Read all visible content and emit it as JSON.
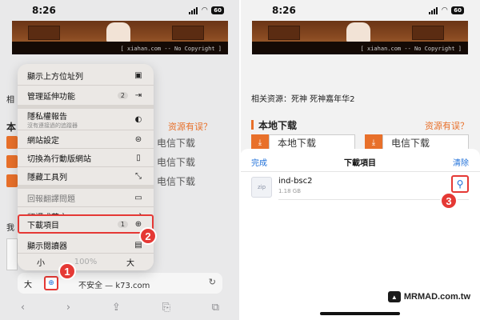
{
  "left": {
    "status_time": "8:26",
    "battery": "60",
    "banner_copyright": "[ xiahan.com -- No Copyright ]",
    "page_frag_related": "相",
    "page_frag_local": "本",
    "page_warn": "资源有误？",
    "page_dl_texts": [
      "电信下载",
      "电信下载",
      "电信下载"
    ],
    "page_frag_comment": "我",
    "menu": {
      "items": [
        {
          "label": "顯示上方位址列",
          "icon": "address-bar-icon"
        },
        {
          "label": "管理延伸功能",
          "badge": "2",
          "icon": "extension-icon"
        },
        {
          "label": "隱私權報告",
          "sub": "沒有連接過的追蹤器",
          "icon": "shield-icon"
        },
        {
          "label": "網站設定",
          "icon": "website-settings-icon"
        },
        {
          "label": "切換為行動版網站",
          "icon": "mobile-site-icon"
        },
        {
          "label": "隱藏工具列",
          "icon": "hide-toolbar-icon"
        },
        {
          "label": "回報翻譯問題",
          "icon": "report-icon"
        },
        {
          "label": "翻譯成英文",
          "icon": "translate-icon"
        },
        {
          "label": "下載項目",
          "badge": "1",
          "icon": "download-icon"
        },
        {
          "label": "顯示閱讀器",
          "icon": "reader-icon"
        }
      ],
      "zoom_small": "小",
      "zoom_pct": "100%",
      "zoom_large": "大"
    },
    "url_aa": "大",
    "url_address": "不安全 — k73.com",
    "callout1": "1",
    "callout2": "2"
  },
  "right": {
    "status_time": "8:26",
    "battery": "60",
    "banner_copyright": "[ xiahan.com -- No Copyright ]",
    "related": "相关资源：死神 死神嘉年华2",
    "local_download": "本地下载",
    "warn": "资源有误？",
    "local_dl_btn": "本地下载",
    "telecom_dl_btn": "电信下载",
    "sheet": {
      "done": "完成",
      "title": "下載項目",
      "clear": "清除"
    },
    "file": {
      "icon_text": "zip",
      "name": "ind-bsc2",
      "size": "1.18 GB"
    },
    "callout3": "3",
    "brand": "MRMAD.com.tw"
  },
  "colors": {
    "accent_orange": "#e8702a",
    "callout_red": "#e53935",
    "link_blue": "#1e6fd9"
  }
}
